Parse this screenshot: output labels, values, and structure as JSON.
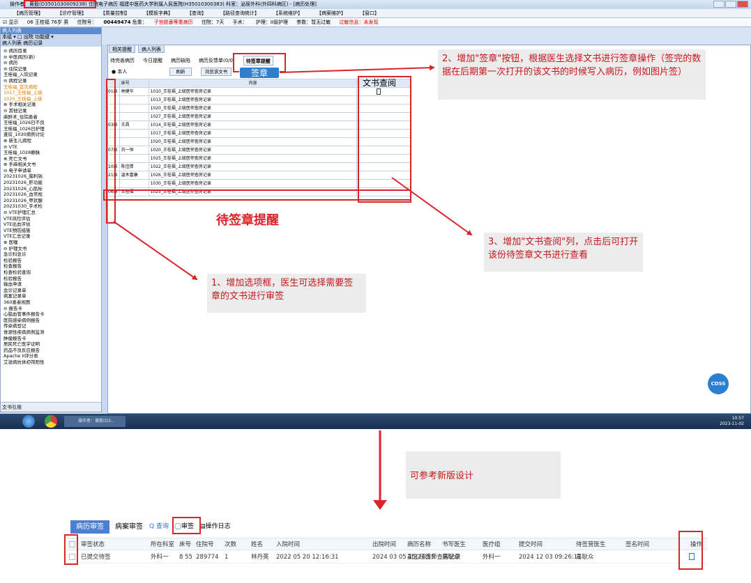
{
  "window": {
    "title": "操作者：黄毅(D3501030009238)   住院电子病历  福建中医药大学附属人民医院(H35010300383)  科室：泌尿外科(外四科病区) - [病历处理]",
    "menu": [
      "【病历管理】",
      "【诊疗管理】",
      "【质量控制】",
      "【模板字典】",
      "【查询】",
      "【路径查询统计】",
      "【系统维护】",
      "【病案维护】",
      "【窗口】"
    ],
    "patient_info": {
      "show": "☑ 显示",
      "bed": "06 王桂福 76岁 男",
      "admission_no_label": "住院号：",
      "admission_no": "00449474",
      "diagnosis_label": "危重：",
      "diagnosis": "子宫脱垂等重病历",
      "days": "住院：7天",
      "surgery": "手术：",
      "nursing": "护理：II级护理",
      "allergy": "参数：暂无过敏",
      "alert": "过敏信息：未发现"
    }
  },
  "sidebar": {
    "header": "病人列表",
    "filter": "本组 ▾ □ 出院 功能键 ▾",
    "tabs": "病人列表  病历记录",
    "tree": [
      "⊖ 病历目录",
      "  ⊖ 中医病历(新)",
      "  ⊖ 病历",
      "    ⊖ 住院记录",
      "       王桂福_入院记录",
      "    ⊖ 病程记录",
      "       王桂福_首次病程",
      "       1017_王桂福_上级",
      "       1020_王桂福_上级",
      "    ⊕ 手术相关记录",
      "    ⊖ 其他记录",
      "       麻醉术_住院患者",
      "       王桂福_1026日不良",
      "       王桂福_1026日护理",
      "       查房_1030病例讨论",
      "    ⊕ 新生儿病程",
      "    ⊖ VTE",
      "       王桂福_1028静脉",
      "    ⊕ 死亡文书",
      "    ⊕ 手麻相关文书",
      "    ⊖ 电子申请单",
      "       20231026_脑利钠",
      "       20231026_肝功能",
      "       20231026_心肌标",
      "       20231026_血常规",
      "       20231026_甲状腺",
      "       20231030_手术检",
      "  ⊖ VTE护理汇总",
      "       VTE风险评估",
      "       VTE出血评估",
      "       VTE预防措施",
      "       VTE汇总记录",
      "  ⊕ 医嘱",
      "  ⊖ 护理文书",
      "    急诊科急诊",
      "    检验报告",
      "    检查报告",
      "    检查检验查询",
      "    检验报告",
      "    输血申请",
      "    会诊记录单",
      "    病案记录单",
      "    360患者视图",
      "  ⊖ 报告卡",
      "    心脑血管事件报告卡",
      "    医院感染病例报告",
      "    传染病登记",
      "    食源性疾病病例监测",
      "    肿瘤报告卡",
      "    居民死亡医学证明",
      "    药品不良反应报告",
      "    Apache II评分表",
      "    艾滋病抗体初筛阳性"
    ],
    "bottom": "文书引用"
  },
  "main": {
    "tabs": [
      "相关提醒",
      "病人列表"
    ],
    "sub_tabs": [
      "待完善病历",
      "今日提醒",
      "病历缺陷",
      "病历反馈单(0/0)",
      "待签章提醒"
    ],
    "radio_label": "● 本人",
    "refresh_button": "刷新",
    "browse_button": "浏览该文书",
    "grid_headers": [
      "床号",
      "内容"
    ],
    "rows": [
      {
        "bed": "01床",
        "name": "林健华",
        "content": "1010_王桂福_上级医师查房记录"
      },
      {
        "bed": "",
        "name": "",
        "content": "1013_王桂福_上级医师查房记录"
      },
      {
        "bed": "",
        "name": "",
        "content": "1020_王桂福_上级医师查房记录"
      },
      {
        "bed": "",
        "name": "",
        "content": "1027_王桂福_上级医师查房记录"
      },
      {
        "bed": "03床",
        "name": "王昌",
        "content": "1014_王桂福_上级医师查房记录"
      },
      {
        "bed": "",
        "name": "",
        "content": "1017_王桂福_上级医师查房记录"
      },
      {
        "bed": "",
        "name": "",
        "content": "1020_王桂福_上级医师查房记录"
      },
      {
        "bed": "07床",
        "name": "刘一恒",
        "content": "1020_王桂福_上级医师查房记录"
      },
      {
        "bed": "",
        "name": "",
        "content": "1025_王桂福_上级医师查房记录"
      },
      {
        "bed": "10床",
        "name": "陈佳倩",
        "content": "1022_王桂福_上级医师查房记录"
      },
      {
        "bed": "21床",
        "name": "温木富康",
        "content": "1026_王桂福_上级医师查房记录"
      },
      {
        "bed": "",
        "name": "",
        "content": "1030_王桂福_上级医师查房记录"
      },
      {
        "bed": "06床",
        "name": "王桂福",
        "content": "1025_王桂福_上级医师查房记录"
      }
    ],
    "cdss": "CDSS"
  },
  "annotations": {
    "sign_button": "签章",
    "doc_view_col": "文书查阅",
    "pending_title": "待签章提醒",
    "callout_2": "2、增加\"签章\"按钮，根据医生选择文书进行签章操作（签完的数据在后期第一次打开的该文书的时候写入病历，例如图片签）",
    "callout_3": "3、增加\"文书查阅\"列，点击后可打开该份待签章文书进行查看",
    "callout_1": "1、增加选项框，医生可选择需要签章的文书进行审签",
    "reference": "可参考新版设计"
  },
  "taskbar": {
    "item": "操作者：黄毅(D3...",
    "time": "10:57",
    "date": "2023-11-02"
  },
  "new_design": {
    "tabs": [
      "病历审签",
      "病案审签"
    ],
    "tools": [
      "Q 查询",
      "审签",
      "操作日志"
    ],
    "headers": [
      "审签状态",
      "所在科室",
      "床号",
      "住院号",
      "次数",
      "姓名",
      "入院时间",
      "出院时间",
      "病历名称",
      "书写医生",
      "医疗组",
      "提交时间",
      "待签营医生",
      "签名时间",
      "操作"
    ],
    "row": [
      "已提交待签",
      "外科一",
      "8 55",
      "289774",
      "1",
      "林丹英",
      "2022 05 20 12:16:31",
      "2024 03 05 15:24:55",
      "副主任医师查房记录",
      "易耿众",
      "外科一",
      "2024 12 03 09:26:11",
      "易耿众",
      "",
      ""
    ]
  },
  "colors": {
    "accent": "#d9252a",
    "brand": "#4a7fd3"
  }
}
